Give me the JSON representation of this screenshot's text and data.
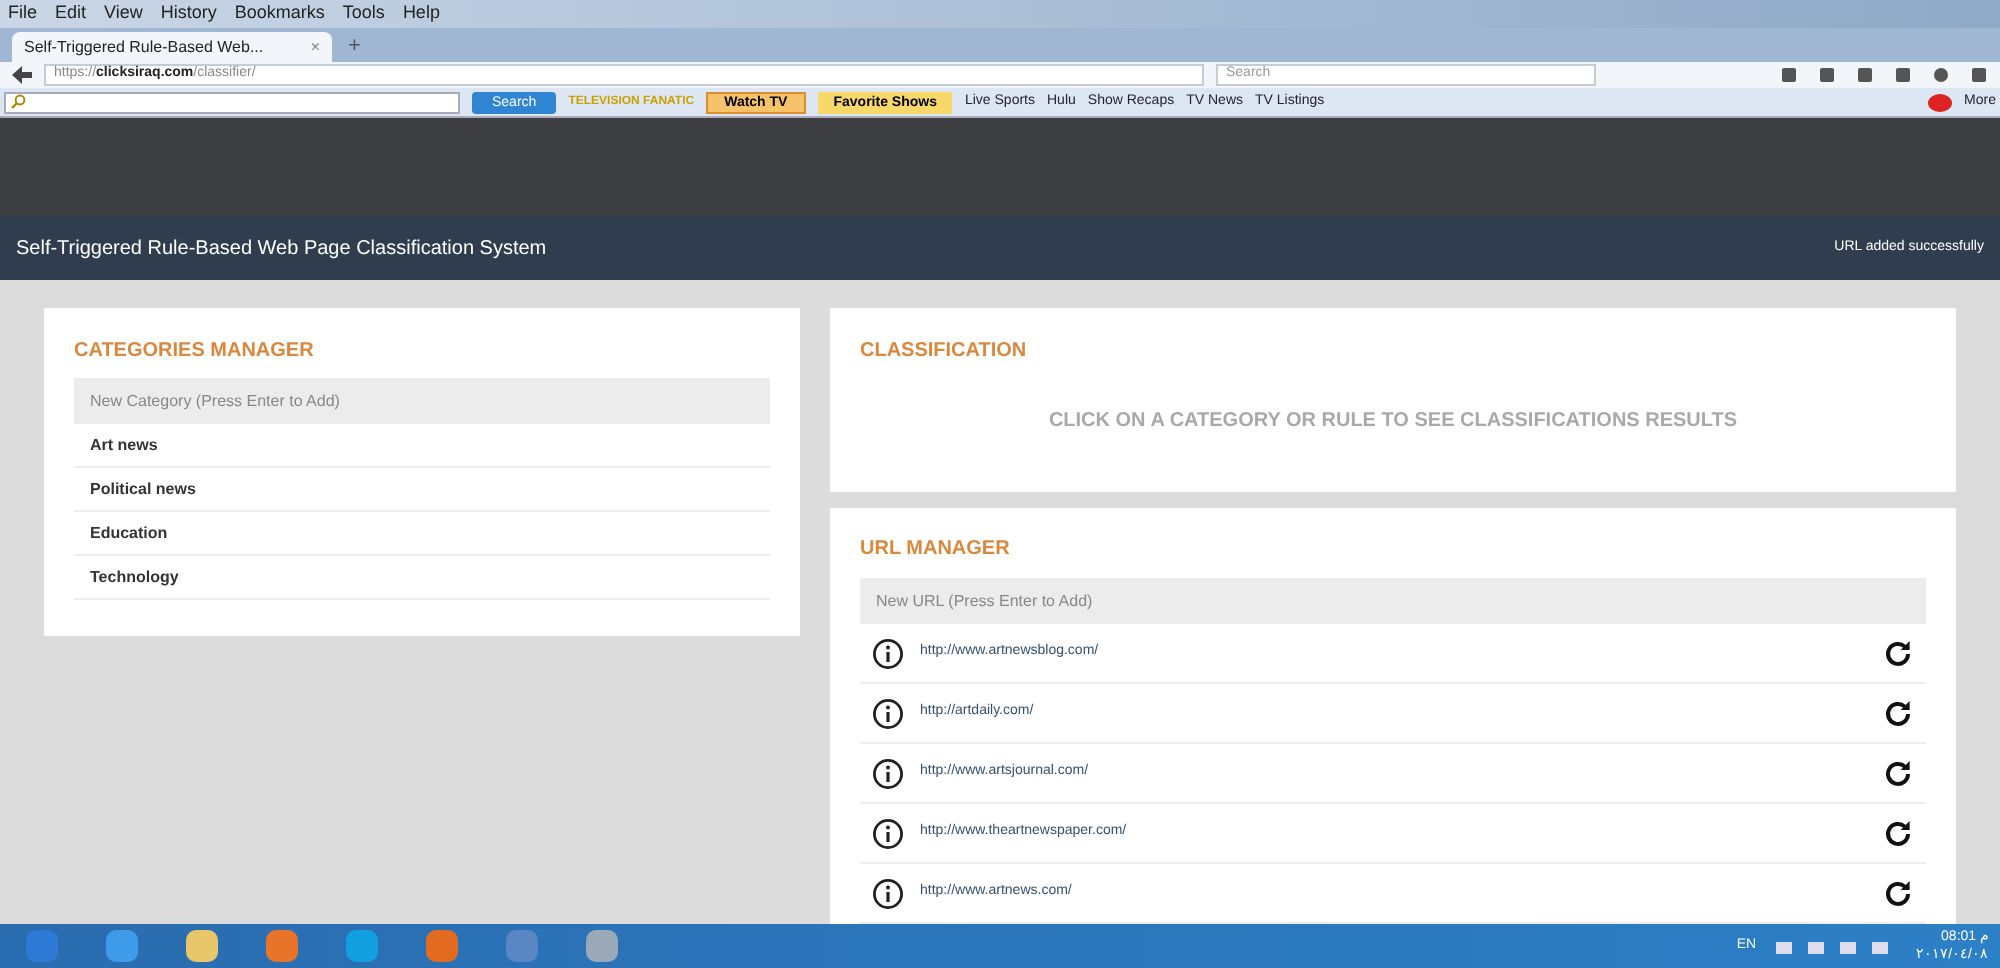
{
  "browser": {
    "menu": [
      "File",
      "Edit",
      "View",
      "History",
      "Bookmarks",
      "Tools",
      "Help"
    ],
    "tab": {
      "title": "Self-Triggered Rule-Based Web...",
      "close": "×",
      "new_tab": "+"
    },
    "address": {
      "scheme": "https://",
      "host": "clicksiraq.com",
      "path": "/classifier/"
    },
    "search": {
      "placeholder": "Search"
    },
    "toolbar": {
      "search_button": "Search",
      "logo": "TELEVISION FANATIC",
      "watch_tv": "Watch TV",
      "favorite_shows": "Favorite Shows",
      "links": [
        "Live Sports",
        "Hulu",
        "Show Recaps",
        "TV News",
        "TV Listings"
      ],
      "more": "More"
    }
  },
  "app": {
    "title": "Self-Triggered Rule-Based Web Page Classification System",
    "notice": "URL added successfully"
  },
  "categories": {
    "title": "CATEGORIES MANAGER",
    "placeholder": "New Category (Press Enter to Add)",
    "items": [
      "Art news",
      "Political news",
      "Education",
      "Technology"
    ]
  },
  "classification": {
    "title": "CLASSIFICATION",
    "message": "CLICK ON A CATEGORY OR RULE TO SEE CLASSIFICATIONS RESULTS"
  },
  "urls": {
    "title": "URL MANAGER",
    "placeholder": "New URL (Press Enter to Add)",
    "items": [
      "http://www.artnewsblog.com/",
      "http://artdaily.com/",
      "http://www.artsjournal.com/",
      "http://www.theartnewspaper.com/",
      "http://www.artnews.com/"
    ]
  },
  "taskbar": {
    "language": "EN",
    "time": "08:01 م",
    "date": "٢٠١٧/٠٤/٠٨"
  }
}
